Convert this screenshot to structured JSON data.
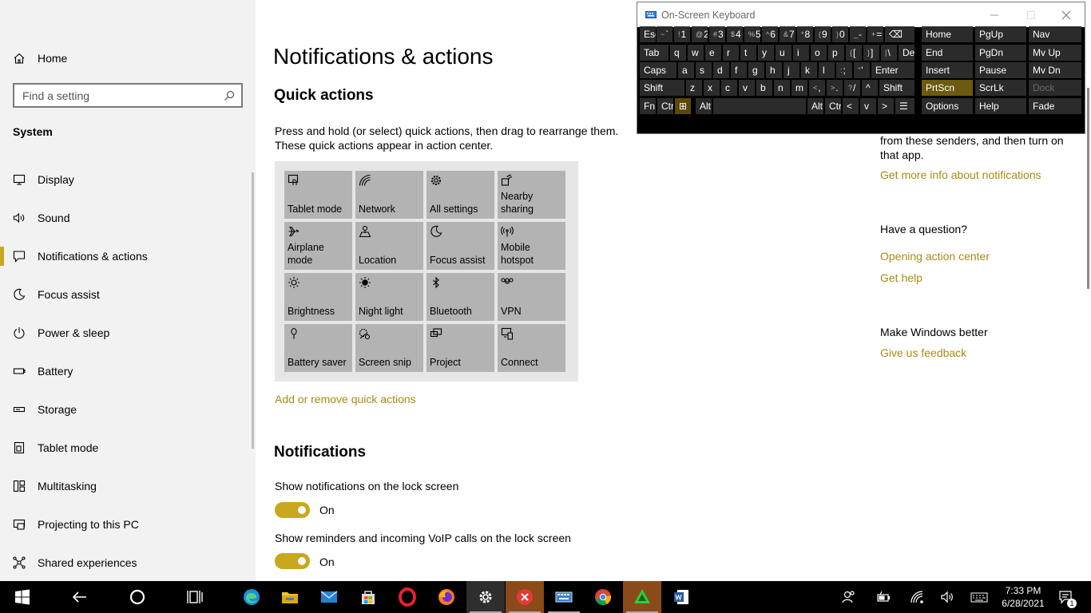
{
  "sidebar": {
    "home_label": "Home",
    "search_placeholder": "Find a setting",
    "section_label": "System",
    "items": [
      {
        "label": "Display",
        "icon": "display-icon"
      },
      {
        "label": "Sound",
        "icon": "speaker-icon"
      },
      {
        "label": "Notifications & actions",
        "icon": "notification-icon",
        "active": true
      },
      {
        "label": "Focus assist",
        "icon": "moon-icon"
      },
      {
        "label": "Power & sleep",
        "icon": "power-icon"
      },
      {
        "label": "Battery",
        "icon": "battery-icon"
      },
      {
        "label": "Storage",
        "icon": "storage-icon"
      },
      {
        "label": "Tablet mode",
        "icon": "tablet-icon"
      },
      {
        "label": "Multitasking",
        "icon": "multitasking-icon"
      },
      {
        "label": "Projecting to this PC",
        "icon": "projecting-icon"
      },
      {
        "label": "Shared experiences",
        "icon": "shared-icon"
      }
    ]
  },
  "main": {
    "title": "Notifications & actions",
    "quick_actions_heading": "Quick actions",
    "quick_actions_desc": "Press and hold (or select) quick actions, then drag to rearrange them. These quick actions appear in action center.",
    "tiles": [
      {
        "label": "Tablet mode",
        "icon": "tablet-mode-icon"
      },
      {
        "label": "Network",
        "icon": "network-icon"
      },
      {
        "label": "All settings",
        "icon": "gear-icon"
      },
      {
        "label": "Nearby sharing",
        "icon": "nearby-sharing-icon"
      },
      {
        "label": "Airplane mode",
        "icon": "airplane-icon"
      },
      {
        "label": "Location",
        "icon": "location-icon"
      },
      {
        "label": "Focus assist",
        "icon": "moon-icon"
      },
      {
        "label": "Mobile hotspot",
        "icon": "hotspot-icon"
      },
      {
        "label": "Brightness",
        "icon": "brightness-icon"
      },
      {
        "label": "Night light",
        "icon": "night-light-icon"
      },
      {
        "label": "Bluetooth",
        "icon": "bluetooth-icon"
      },
      {
        "label": "VPN",
        "icon": "vpn-icon"
      },
      {
        "label": "Battery saver",
        "icon": "battery-saver-icon"
      },
      {
        "label": "Screen snip",
        "icon": "screen-snip-icon"
      },
      {
        "label": "Project",
        "icon": "project-icon"
      },
      {
        "label": "Connect",
        "icon": "connect-icon"
      }
    ],
    "add_remove_link": "Add or remove quick actions",
    "notifications_heading": "Notifications",
    "setting1_label": "Show notifications on the lock screen",
    "setting1_state": "On",
    "setting2_label": "Show reminders and incoming VoIP calls on the lock screen",
    "setting2_state": "On"
  },
  "right_panel": {
    "partial_text": "from these senders, and then turn on that app.",
    "info_link": "Get more info about notifications",
    "question_heading": "Have a question?",
    "link_action_center": "Opening action center",
    "link_help": "Get help",
    "better_heading": "Make Windows better",
    "link_feedback": "Give us feedback"
  },
  "osk": {
    "title": "On-Screen Keyboard",
    "rows": [
      [
        {
          "l": "Esc"
        },
        {
          "s": "~",
          "l": "`"
        },
        {
          "s": "!",
          "l": "1"
        },
        {
          "s": "@",
          "l": "2"
        },
        {
          "s": "#",
          "l": "3"
        },
        {
          "s": "$",
          "l": "4"
        },
        {
          "s": "%",
          "l": "5"
        },
        {
          "s": "^",
          "l": "6"
        },
        {
          "s": "&",
          "l": "7"
        },
        {
          "s": "*",
          "l": "8"
        },
        {
          "s": "(",
          "l": "9"
        },
        {
          "s": ")",
          "l": "0"
        },
        {
          "s": "_",
          "l": "-"
        },
        {
          "s": "+",
          "l": "="
        },
        {
          "l": "⌫"
        }
      ],
      [
        {
          "l": "Tab"
        },
        {
          "l": "q"
        },
        {
          "l": "w"
        },
        {
          "l": "e"
        },
        {
          "l": "r"
        },
        {
          "l": "t"
        },
        {
          "l": "y"
        },
        {
          "l": "u"
        },
        {
          "l": "i"
        },
        {
          "l": "o"
        },
        {
          "l": "p"
        },
        {
          "s": "{",
          "l": "["
        },
        {
          "s": "}",
          "l": "]"
        },
        {
          "s": "|",
          "l": "\\"
        },
        {
          "l": "Del"
        }
      ],
      [
        {
          "l": "Caps"
        },
        {
          "l": "a"
        },
        {
          "l": "s"
        },
        {
          "l": "d"
        },
        {
          "l": "f"
        },
        {
          "l": "g"
        },
        {
          "l": "h"
        },
        {
          "l": "j"
        },
        {
          "l": "k"
        },
        {
          "l": "l"
        },
        {
          "s": ":",
          "l": ";"
        },
        {
          "s": "\"",
          "l": "'"
        },
        {
          "l": "Enter"
        }
      ],
      [
        {
          "l": "Shift"
        },
        {
          "l": "z"
        },
        {
          "l": "x"
        },
        {
          "l": "c"
        },
        {
          "l": "v"
        },
        {
          "l": "b"
        },
        {
          "l": "n"
        },
        {
          "l": "m"
        },
        {
          "s": "<",
          "l": ","
        },
        {
          "s": ">",
          "l": "."
        },
        {
          "s": "?",
          "l": "/"
        },
        {
          "l": "^"
        },
        {
          "l": "Shift"
        }
      ],
      [
        {
          "l": "Fn"
        },
        {
          "l": "Ctrl"
        },
        {
          "l": "⊞"
        },
        {
          "l": "Alt"
        },
        {
          "l": ""
        },
        {
          "l": "Alt"
        },
        {
          "l": "Ctrl"
        },
        {
          "l": "<"
        },
        {
          "l": "v"
        },
        {
          "l": ">"
        },
        {
          "l": "☰"
        }
      ]
    ],
    "nav_keys": [
      [
        "Home",
        "PgUp",
        "Nav"
      ],
      [
        "End",
        "PgDn",
        "Mv Up"
      ],
      [
        "Insert",
        "Pause",
        "Mv Dn"
      ],
      [
        "PrtScn",
        "ScrLk",
        "Dock"
      ],
      [
        "Options",
        "Help",
        "Fade"
      ]
    ]
  },
  "taskbar": {
    "time": "7:33 PM",
    "date": "6/28/2021",
    "notification_count": "1",
    "apps": [
      "start-icon",
      "back-icon",
      "cortana-icon",
      "task-view-icon",
      "edge-icon",
      "file-explorer-icon",
      "mail-icon",
      "store-icon",
      "opera-icon",
      "firefox-icon",
      "settings-icon",
      "x-app-icon",
      "osk-app-icon",
      "chrome-icon",
      "green-app-icon",
      "word-icon"
    ],
    "colors": {
      "accent": "#c8a81c",
      "link": "#a88a12"
    }
  }
}
